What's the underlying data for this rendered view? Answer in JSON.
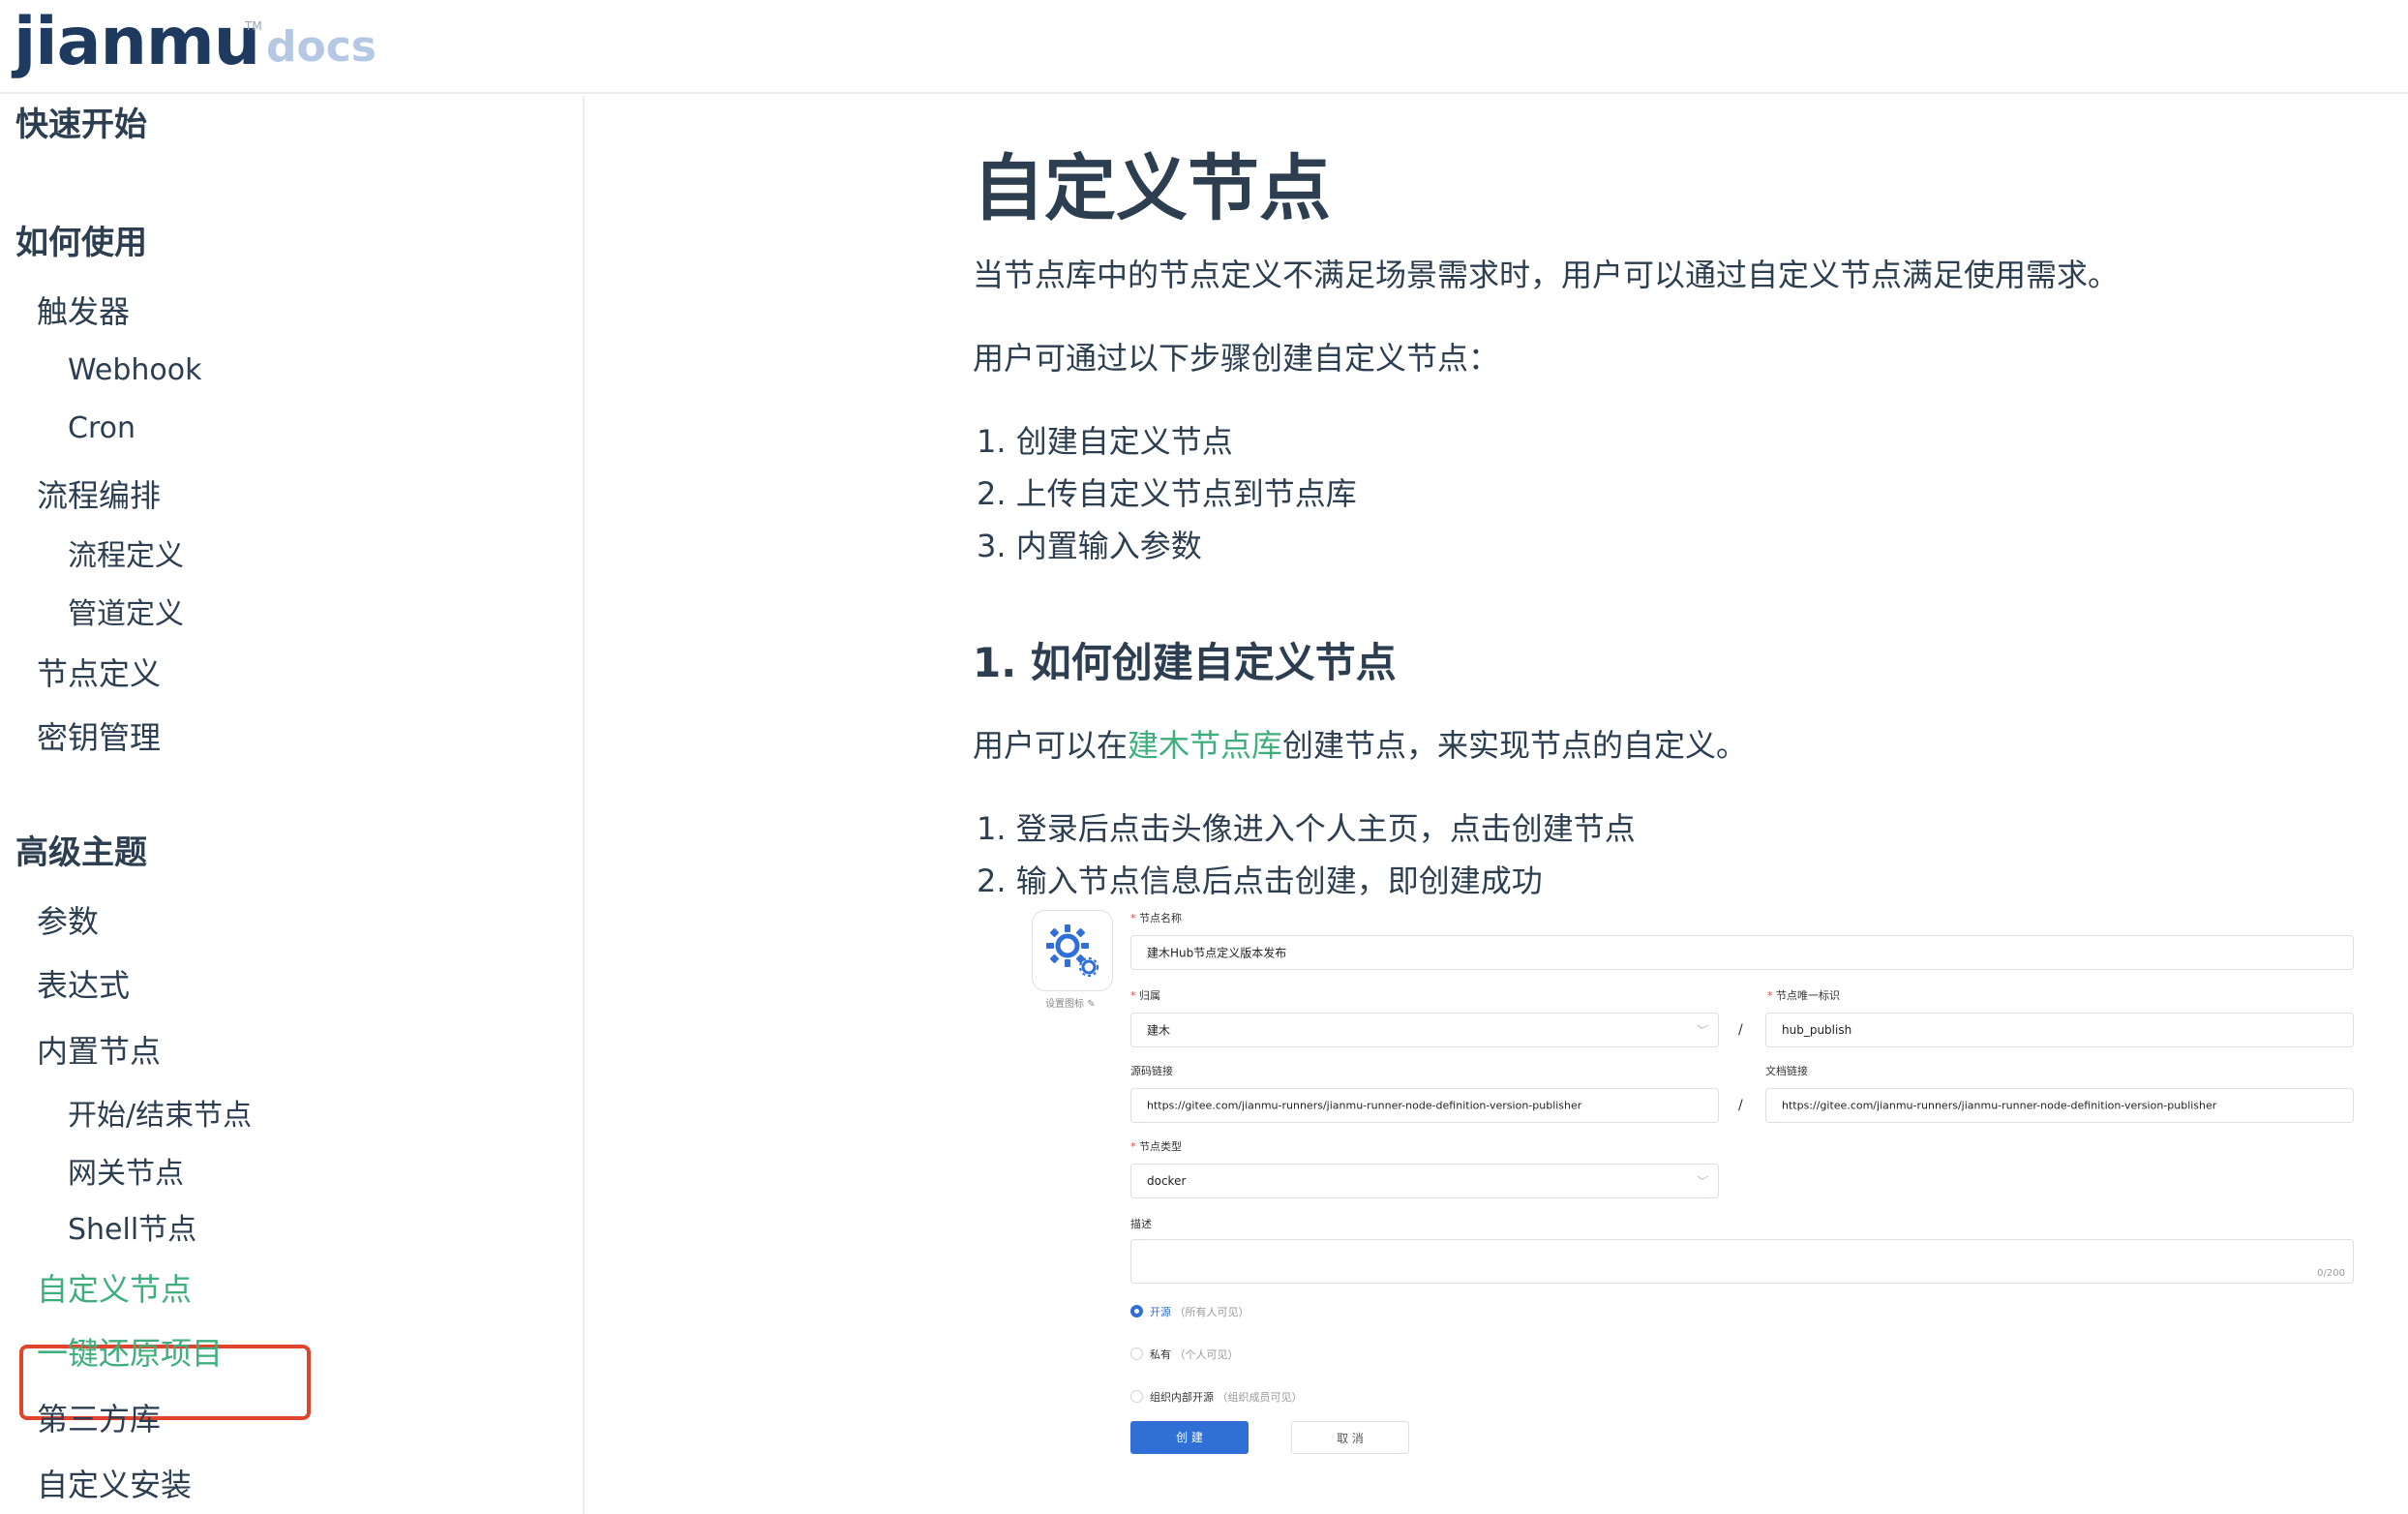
{
  "header": {
    "logo_text": "jianmu",
    "logo_tm": "TM",
    "logo_suffix": "docs"
  },
  "sidebar": {
    "quick_start": "快速开始",
    "how_to_use": "如何使用",
    "trigger": "触发器",
    "webhook": "Webhook",
    "cron": "Cron",
    "flow_orchestration": "流程编排",
    "flow_definition": "流程定义",
    "pipeline_definition": "管道定义",
    "node_definition": "节点定义",
    "secret_management": "密钥管理",
    "advanced_topics": "高级主题",
    "params": "参数",
    "expression": "表达式",
    "builtin_nodes": "内置节点",
    "start_end_nodes": "开始/结束节点",
    "gateway_nodes": "网关节点",
    "shell_nodes": "Shell节点",
    "custom_nodes": "自定义节点",
    "one_click_restore": "一键还原项目",
    "third_party_libs": "第三方库",
    "custom_install": "自定义安装"
  },
  "main": {
    "title": "自定义节点",
    "intro": "当节点库中的节点定义不满足场景需求时，用户可以通过自定义节点满足使用需求。",
    "steps_intro": "用户可通过以下步骤创建自定义节点：",
    "steps": [
      "1. 创建自定义节点",
      "2. 上传自定义节点到节点库",
      "3. 内置输入参数"
    ],
    "section1_title": "1. 如何创建自定义节点",
    "section1_text_before": "用户可以在",
    "section1_link": "建木节点库",
    "section1_text_after": "创建节点，来实现节点的自定义。",
    "section1_steps": [
      "1. 登录后点击头像进入个人主页，点击创建节点",
      "2. 输入节点信息后点击创建，即创建成功"
    ]
  },
  "form": {
    "set_icon": "设置图标",
    "node_name_label": "节点名称",
    "node_name_value": "建木Hub节点定义版本发布",
    "owner_label": "归属",
    "owner_value": "建木",
    "node_id_label": "节点唯一标识",
    "node_id_value": "hub_publish",
    "slash": "/",
    "source_link_label": "源码链接",
    "source_link_value": "https://gitee.com/jianmu-runners/jianmu-runner-node-definition-version-publisher",
    "doc_link_label": "文档链接",
    "doc_link_value": "https://gitee.com/jianmu-runners/jianmu-runner-node-definition-version-publisher",
    "node_type_label": "节点类型",
    "node_type_value": "docker",
    "desc_label": "描述",
    "desc_counter": "0/200",
    "radio_open": "开源",
    "radio_open_hint": "（所有人可见）",
    "radio_private": "私有",
    "radio_private_hint": "（个人可见）",
    "radio_org": "组织内部开源",
    "radio_org_hint": "（组织成员可见）",
    "create_button": "创 建",
    "cancel_button": "取 消",
    "required_mark": "*"
  }
}
